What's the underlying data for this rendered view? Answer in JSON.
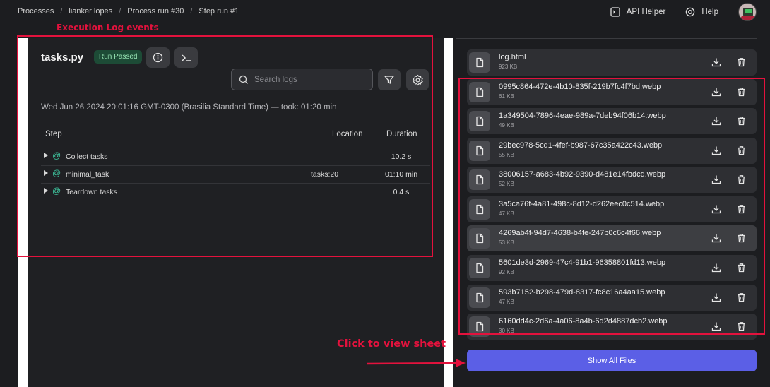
{
  "breadcrumb": [
    "Processes",
    "lianker lopes",
    "Process run #30",
    "Step run #1"
  ],
  "header": {
    "api_helper": "API Helper",
    "help": "Help",
    "avatar": "user-avatar"
  },
  "log_panel": {
    "file_title": "tasks.py",
    "status_badge": "Run Passed",
    "search_placeholder": "Search logs",
    "timestamp": "Wed Jun 26 2024 20:01:16 GMT-0300 (Brasilia Standard Time) — took: 01:20 min",
    "columns": {
      "step": "Step",
      "location": "Location",
      "duration": "Duration"
    },
    "rows": [
      {
        "name": "Collect tasks",
        "location": "",
        "duration": "10.2 s"
      },
      {
        "name": "minimal_task",
        "location": "tasks:20",
        "duration": "01:10 min"
      },
      {
        "name": "Teardown tasks",
        "location": "",
        "duration": "0.4 s"
      }
    ]
  },
  "files": [
    {
      "name": "log.html",
      "size": "923 KB"
    },
    {
      "name": "0995c864-472e-4b10-835f-219b7fc4f7bd.webp",
      "size": "61 KB"
    },
    {
      "name": "1a349504-7896-4eae-989a-7deb94f06b14.webp",
      "size": "49 KB"
    },
    {
      "name": "29bec978-5cd1-4fef-b987-67c35a422c43.webp",
      "size": "55 KB"
    },
    {
      "name": "38006157-a683-4b92-9390-d481e14fbdcd.webp",
      "size": "52 KB"
    },
    {
      "name": "3a5ca76f-4a81-498c-8d12-d262eec0c514.webp",
      "size": "47 KB"
    },
    {
      "name": "4269ab4f-94d7-4638-b4fe-247b0c6c4f66.webp",
      "size": "53 KB"
    },
    {
      "name": "5601de3d-2969-47c4-91b1-96358801fd13.webp",
      "size": "92 KB"
    },
    {
      "name": "593b7152-b298-479d-8317-fc8c16a4aa15.webp",
      "size": "47 KB"
    },
    {
      "name": "6160dd4c-2d6a-4a06-8a4b-6d2d4887dcb2.webp",
      "size": "30 KB"
    }
  ],
  "show_all_label": "Show All Files",
  "annotations": {
    "execution_log": "Execution Log events",
    "click_sheet": "Click to view sheet",
    "color": "#e3123d"
  },
  "colors": {
    "accent": "#5b5fe6",
    "badge_bg": "#1d4b36",
    "badge_text": "#9be8b8",
    "step_icon": "#3fc7a0"
  }
}
